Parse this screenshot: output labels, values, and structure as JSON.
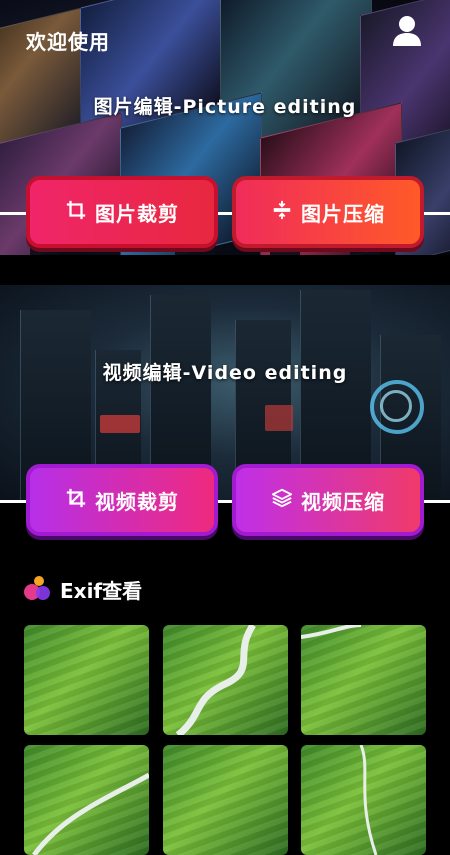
{
  "header": {
    "welcome_text": "欢迎使用",
    "user_icon": "user-icon"
  },
  "picture_section": {
    "title": "图片编辑-Picture editing",
    "buttons": [
      {
        "label": "图片裁剪",
        "icon": "crop-icon"
      },
      {
        "label": "图片压缩",
        "icon": "compress-icon"
      }
    ]
  },
  "video_section": {
    "title": "视频编辑-Video editing",
    "buttons": [
      {
        "label": "视频裁剪",
        "icon": "crop-icon"
      },
      {
        "label": "视频压缩",
        "icon": "layers-icon"
      }
    ]
  },
  "exif": {
    "title": "Exif查看",
    "icon": "exif-logo-icon",
    "thumbnails": [
      {
        "name": "rice-terrace-1"
      },
      {
        "name": "rice-terrace-2"
      },
      {
        "name": "rice-terrace-3"
      },
      {
        "name": "rice-terrace-4"
      },
      {
        "name": "rice-terrace-5"
      },
      {
        "name": "rice-terrace-6"
      }
    ]
  },
  "colors": {
    "picture_button_start": "#f0256a",
    "picture_button_end": "#ff5a28",
    "video_button_start": "#b62fe8",
    "video_button_end": "#ef2a7e",
    "background": "#000000"
  }
}
